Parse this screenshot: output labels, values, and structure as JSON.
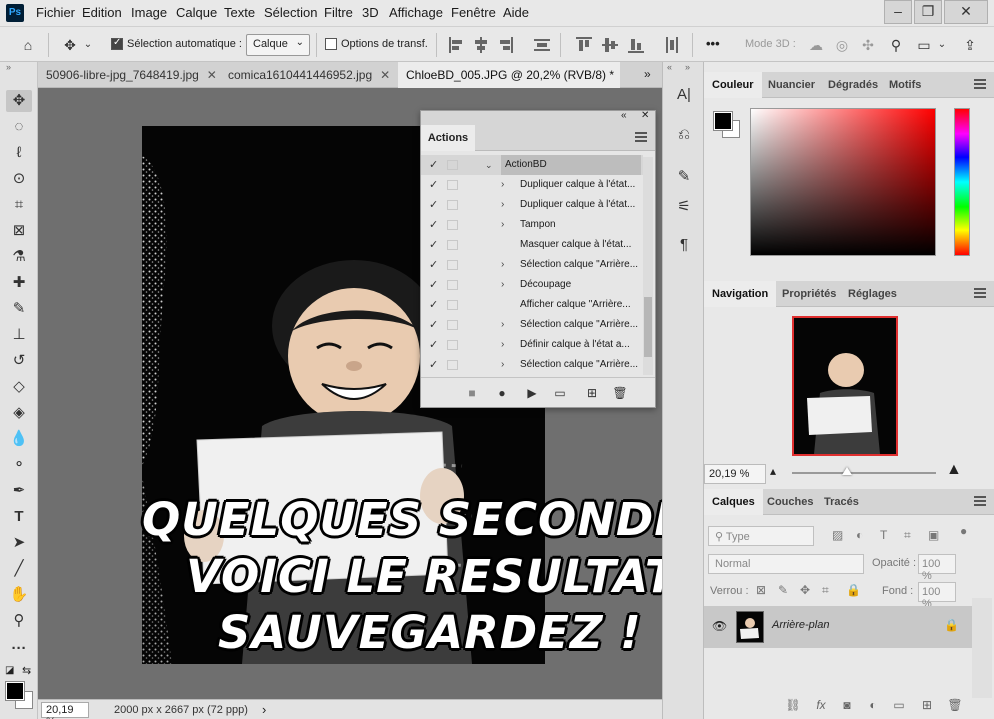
{
  "menubar": {
    "logo": "Ps",
    "items": [
      "Fichier",
      "Edition",
      "Image",
      "Calque",
      "Texte",
      "Sélection",
      "Filtre",
      "3D",
      "Affichage",
      "Fenêtre",
      "Aide"
    ],
    "minimize": "–",
    "restore": "❐",
    "close": "✕"
  },
  "options": {
    "auto_select_label": "Sélection automatique :",
    "auto_select_value": "Calque",
    "transform_label": "Options de transf.",
    "more": "•••",
    "mode3d": "Mode 3D :"
  },
  "tabs": [
    {
      "label": "50906-libre-jpg_7648419.jpg",
      "close": "✕"
    },
    {
      "label": "comica1610441446952.jpg",
      "close": "✕"
    },
    {
      "label": "ChloeBD_005.JPG @ 20,2% (RVB/8) *",
      "close": "✕"
    }
  ],
  "tabs_overflow": "»",
  "canvas": {
    "caption_lines": [
      "QUELQUES SECONDES",
      "VOICI LE RESULTAT!",
      "SAUVEGARDEZ !"
    ]
  },
  "status": {
    "zoom": "20,19 %",
    "doc_info": "2000 px x 2667 px (72 ppp)",
    "arrow": "›"
  },
  "actions_panel": {
    "title": "Actions",
    "collapse": "«",
    "close": "✕",
    "set_name": "ActionBD",
    "items": [
      {
        "label": "Dupliquer calque à l'état...",
        "expandable": true
      },
      {
        "label": "Dupliquer calque à l'état...",
        "expandable": true
      },
      {
        "label": "Tampon",
        "expandable": true
      },
      {
        "label": "Masquer calque à l'état...",
        "expandable": false
      },
      {
        "label": "Sélection calque \"Arrière...",
        "expandable": true
      },
      {
        "label": "Découpage",
        "expandable": true
      },
      {
        "label": "Afficher calque \"Arrière...",
        "expandable": false
      },
      {
        "label": "Sélection calque \"Arrière...",
        "expandable": true
      },
      {
        "label": "Définir calque à l'état a...",
        "expandable": true
      },
      {
        "label": "Sélection calque \"Arrière...",
        "expandable": true
      }
    ],
    "check": "✓"
  },
  "color_panel": {
    "tabs": [
      "Couleur",
      "Nuancier",
      "Dégradés",
      "Motifs"
    ],
    "fg": "#000000",
    "bg": "#ffffff"
  },
  "nav_panel": {
    "tabs": [
      "Navigation",
      "Propriétés",
      "Réglages"
    ],
    "zoom": "20,19 %"
  },
  "layers_panel": {
    "tabs": [
      "Calques",
      "Couches",
      "Tracés"
    ],
    "filter_placeholder": "Type",
    "blend_mode": "Normal",
    "opacity_label": "Opacité :",
    "opacity_value": "100 %",
    "lock_label": "Verrou :",
    "fill_label": "Fond :",
    "fill_value": "100 %",
    "layer_name": "Arrière-plan"
  }
}
